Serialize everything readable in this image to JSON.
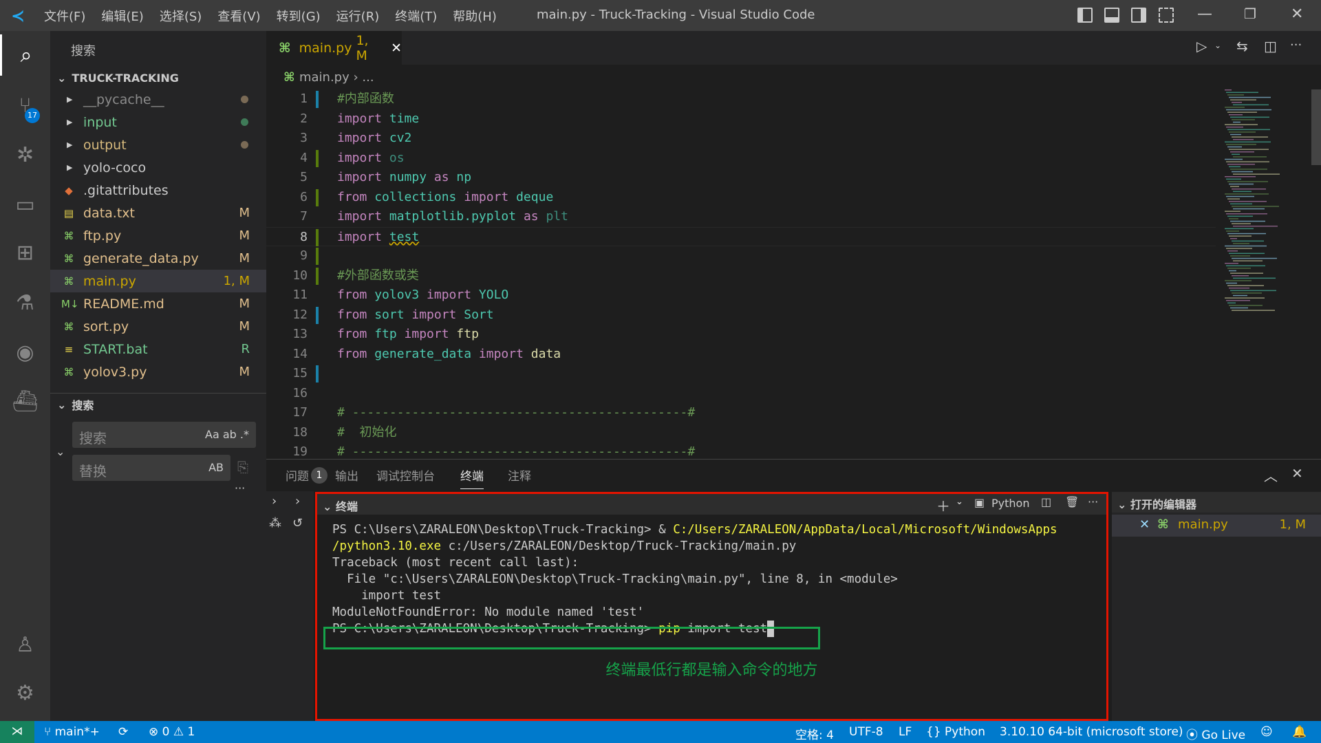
{
  "titlebar": {
    "menus": [
      "文件(F)",
      "编辑(E)",
      "选择(S)",
      "查看(V)",
      "转到(G)",
      "运行(R)",
      "终端(T)",
      "帮助(H)"
    ],
    "title": "main.py - Truck-Tracking - Visual Studio Code"
  },
  "activity": {
    "source_control_badge": "17"
  },
  "sidebar": {
    "title": "搜索",
    "folder": "TRUCK-TRACKING",
    "files": [
      {
        "name": "__pycache__",
        "type": "folder",
        "color": "#8b8b8b",
        "dot": "#7a6a55"
      },
      {
        "name": "input",
        "type": "folder",
        "color": "#73c991",
        "dot": "#3f7b58"
      },
      {
        "name": "output",
        "type": "folder",
        "color": "#d7ba7d",
        "dot": "#7a6a55"
      },
      {
        "name": "yolo-coco",
        "type": "folder",
        "color": "#cccccc"
      },
      {
        "name": ".gitattributes",
        "type": "git",
        "color": "#cccccc"
      },
      {
        "name": "data.txt",
        "type": "txt",
        "color": "#e2c08d",
        "status": "M"
      },
      {
        "name": "ftp.py",
        "type": "py",
        "color": "#e2c08d",
        "status": "M"
      },
      {
        "name": "generate_data.py",
        "type": "py",
        "color": "#e2c08d",
        "status": "M"
      },
      {
        "name": "main.py",
        "type": "py",
        "color": "#cca700",
        "status": "1, M",
        "selected": true
      },
      {
        "name": "README.md",
        "type": "md",
        "color": "#e2c08d",
        "status": "M"
      },
      {
        "name": "sort.py",
        "type": "py",
        "color": "#e2c08d",
        "status": "M"
      },
      {
        "name": "START.bat",
        "type": "bat",
        "color": "#73c991",
        "status": "R"
      },
      {
        "name": "yolov3.py",
        "type": "py",
        "color": "#e2c08d",
        "status": "M"
      }
    ],
    "search_section": "搜索",
    "search_placeholder": "搜索",
    "search_opts": "Aa  ab  .*",
    "replace_placeholder": "替换",
    "replace_opt": "AB"
  },
  "editor": {
    "tab_name": "main.py",
    "tab_status": "1, M",
    "breadcrumb": "main.py  ›  ...",
    "current_line": 8,
    "lines": [
      [
        [
          "#内部函数",
          "cm"
        ]
      ],
      [
        [
          "import ",
          "kw"
        ],
        [
          "time",
          "mod"
        ]
      ],
      [
        [
          "import ",
          "kw"
        ],
        [
          "cv2",
          "mod"
        ]
      ],
      [
        [
          "import ",
          "kw"
        ],
        [
          "os",
          "dim"
        ]
      ],
      [
        [
          "import ",
          "kw"
        ],
        [
          "numpy ",
          "mod"
        ],
        [
          "as ",
          "kw"
        ],
        [
          "np",
          "mod"
        ]
      ],
      [
        [
          "from ",
          "kw"
        ],
        [
          "collections ",
          "mod"
        ],
        [
          "import ",
          "kw"
        ],
        [
          "deque",
          "mod"
        ]
      ],
      [
        [
          "import ",
          "kw"
        ],
        [
          "matplotlib.pyplot ",
          "mod"
        ],
        [
          "as ",
          "kw"
        ],
        [
          "plt",
          "dim"
        ]
      ],
      [
        [
          "import ",
          "kw"
        ],
        [
          "test",
          "squig mod"
        ]
      ],
      [],
      [
        [
          "#外部函数或类",
          "cm"
        ]
      ],
      [
        [
          "from ",
          "kw"
        ],
        [
          "yolov3 ",
          "mod"
        ],
        [
          "import ",
          "kw"
        ],
        [
          "YOLO",
          "mod"
        ]
      ],
      [
        [
          "from ",
          "kw"
        ],
        [
          "sort ",
          "mod"
        ],
        [
          "import ",
          "kw"
        ],
        [
          "Sort",
          "mod"
        ]
      ],
      [
        [
          "from ",
          "kw"
        ],
        [
          "ftp ",
          "mod"
        ],
        [
          "import ",
          "kw"
        ],
        [
          "ftp",
          "var"
        ]
      ],
      [
        [
          "from ",
          "kw"
        ],
        [
          "generate_data ",
          "mod"
        ],
        [
          "import ",
          "kw"
        ],
        [
          "data",
          "var"
        ]
      ],
      [],
      [],
      [
        [
          "# ---------------------------------------------#",
          "cm"
        ]
      ],
      [
        [
          "#  初始化",
          "cm"
        ]
      ],
      [
        [
          "# ---------------------------------------------#",
          "cm"
        ]
      ]
    ],
    "gutter": {
      "1": "#1b81a8",
      "4": "#587c0c",
      "6": "#587c0c",
      "8": "#587c0c",
      "9": "#587c0c",
      "10": "#587c0c",
      "12": "#1b81a8",
      "15": "#1b81a8"
    }
  },
  "panel": {
    "tabs": [
      "问题",
      "输出",
      "调试控制台",
      "终端",
      "注释"
    ],
    "problems_count": "1",
    "active_tab": 3,
    "terminal_title": "终端",
    "shell": "Python",
    "terminal_lines": [
      [
        [
          "PS C:\\Users\\ZARALEON\\Desktop\\Truck-Tracking> & ",
          ""
        ],
        [
          "C:/Users/ZARALEON/AppData/Local/Microsoft/WindowsApps",
          "yl"
        ]
      ],
      [
        [
          "/python3.10.exe",
          "yl"
        ],
        [
          " c:/Users/ZARALEON/Desktop/Truck-Tracking/main.py",
          ""
        ]
      ],
      [
        [
          "Traceback (most recent call last):",
          ""
        ]
      ],
      [
        [
          "  File \"c:\\Users\\ZARALEON\\Desktop\\Truck-Tracking\\main.py\", line 8, in <module>",
          ""
        ]
      ],
      [
        [
          "    import test",
          ""
        ]
      ],
      [
        [
          "ModuleNotFoundError: No module named 'test'",
          ""
        ]
      ],
      [
        [
          "PS C:\\Users\\ZARALEON\\Desktop\\Truck-Tracking> ",
          ""
        ],
        [
          "pip",
          "yl"
        ],
        [
          " import test",
          ""
        ]
      ]
    ],
    "annotation": "终端最低行都是输入命令的地方",
    "open_editors_title": "打开的编辑器",
    "open_editor": {
      "name": "main.py",
      "status": "1, M"
    }
  },
  "statusbar": {
    "branch": "main*+",
    "errors": "0",
    "warnings": "1",
    "spaces": "空格: 4",
    "encoding": "UTF-8",
    "eol": "LF",
    "language": "Python",
    "interpreter": "3.10.10 64-bit (microsoft store)",
    "golive": "Go Live"
  },
  "colors": {
    "accent": "#007acc",
    "annotation_box": "#16a34a",
    "highlight_box": "#e51400"
  }
}
